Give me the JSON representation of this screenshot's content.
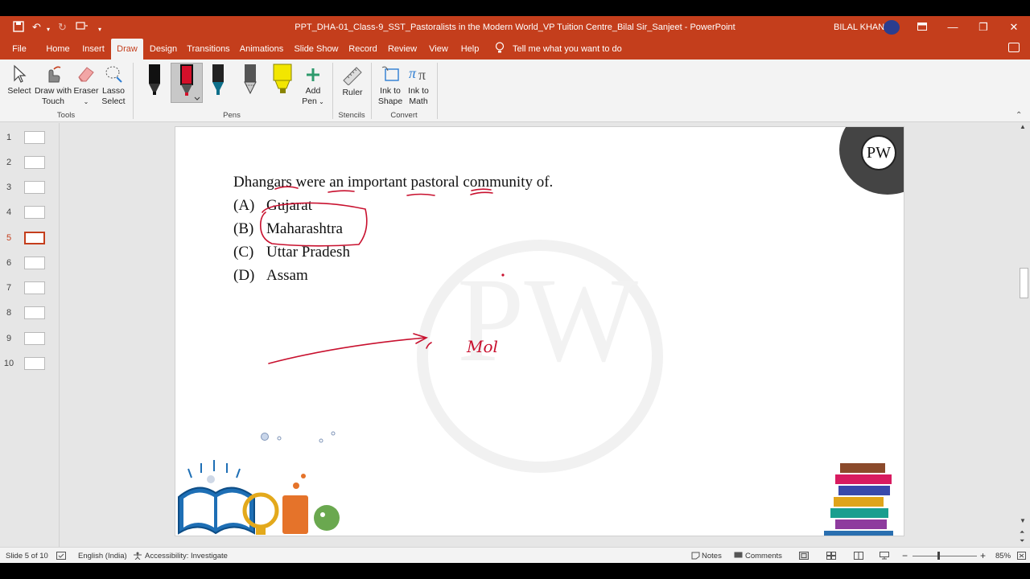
{
  "titlebar": {
    "title": "PPT_DHA-01_Class-9_SST_Pastoralists in the Modern World_VP Tuition Centre_Bilal Sir_Sanjeet  -  PowerPoint",
    "user": "BILAL KHAN",
    "accent": "#c43e1c"
  },
  "tabs": [
    "File",
    "Home",
    "Insert",
    "Draw",
    "Design",
    "Transitions",
    "Animations",
    "Slide Show",
    "Record",
    "Review",
    "View",
    "Help"
  ],
  "active_tab": "Draw",
  "tell_me": "Tell me what you want to do",
  "ribbon": {
    "tools": {
      "select": "Select",
      "draw_touch_1": "Draw with",
      "draw_touch_2": "Touch",
      "eraser": "Eraser",
      "lasso_1": "Lasso",
      "lasso_2": "Select",
      "group": "Tools"
    },
    "pens": {
      "add_pen_1": "Add",
      "add_pen_2": "Pen",
      "group": "Pens",
      "colors": [
        "#111111",
        "#d4102a",
        "#0e6f8a",
        "#444444",
        "#f2e600"
      ]
    },
    "stencils": {
      "ruler": "Ruler",
      "group": "Stencils"
    },
    "convert": {
      "ink_shape_1": "Ink to",
      "ink_shape_2": "Shape",
      "ink_math_1": "Ink to",
      "ink_math_2": "Math",
      "group": "Convert"
    }
  },
  "thumbnails": [
    "1",
    "2",
    "3",
    "4",
    "5",
    "6",
    "7",
    "8",
    "9",
    "10"
  ],
  "active_slide": "5",
  "slide": {
    "question": "Dhangars were an important pastoral community of.",
    "options": [
      {
        "label": "(A)",
        "text": "Gujarat"
      },
      {
        "label": "(B)",
        "text": "Maharashtra"
      },
      {
        "label": "(C)",
        "text": "Uttar Pradesh"
      },
      {
        "label": "(D)",
        "text": "Assam"
      }
    ],
    "logo_text": "PW",
    "ink_text": "Mol",
    "ink_color": "#c8102e"
  },
  "status": {
    "slide_info": "Slide 5 of 10",
    "language": "English (India)",
    "accessibility": "Accessibility: Investigate",
    "notes": "Notes",
    "comments": "Comments",
    "zoom": "85%"
  }
}
